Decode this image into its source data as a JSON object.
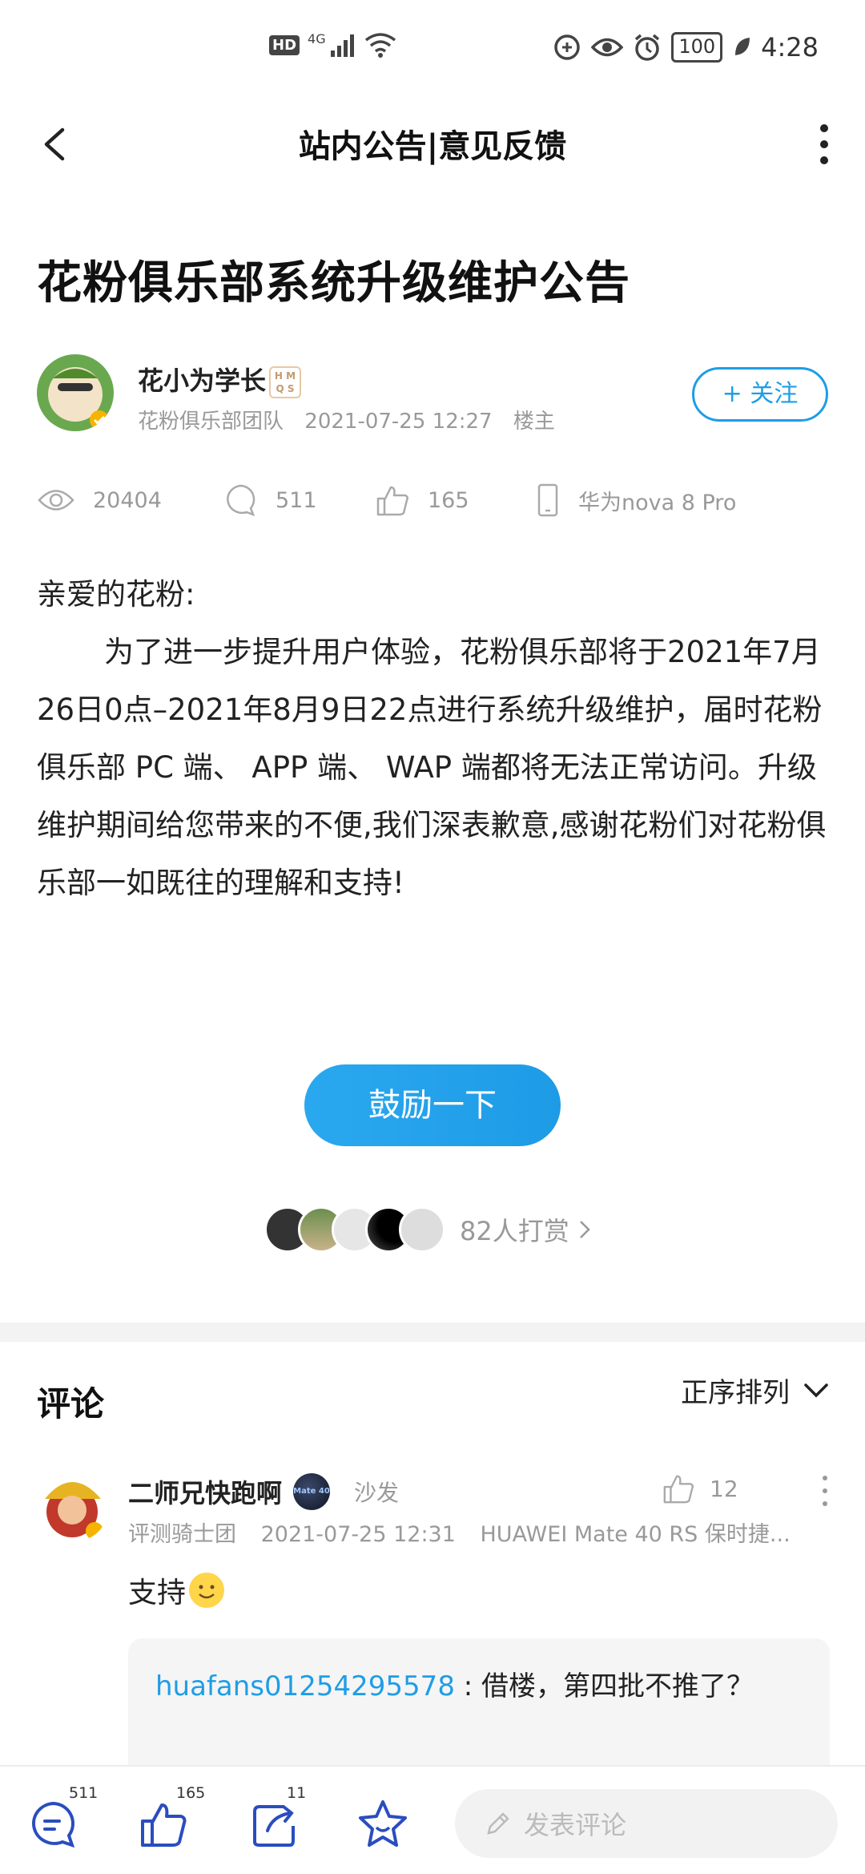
{
  "status_bar": {
    "hd": "HD",
    "network": "4G",
    "battery": "100",
    "time": "4:28"
  },
  "header": {
    "title": "站内公告|意见反馈"
  },
  "post": {
    "title": "花粉俱乐部系统升级维护公告",
    "author": {
      "name": "花小为学长",
      "badge": "H M\nQ S",
      "team": "花粉俱乐部团队",
      "date": "2021-07-25 12:27",
      "role": "楼主"
    },
    "follow_label": "+ 关注",
    "stats": {
      "views": "20404",
      "comments": "511",
      "likes": "165",
      "device": "华为nova 8 Pro"
    },
    "content": {
      "greeting": "亲爱的花粉:",
      "body": "为了进一步提升用户体验，花粉俱乐部将于2021年7月26日0点–2021年8月9日22点进行系统升级维护，届时花粉俱乐部 PC 端、 APP 端、 WAP 端都将无法正常访问。升级维护期间给您带来的不便,我们深表歉意,感谢花粉们对花粉俱乐部一如既往的理解和支持!"
    },
    "cheer_label": "鼓励一下",
    "tips_text": "82人打赏"
  },
  "comments": {
    "title": "评论",
    "sort_label": "正序排列",
    "items": [
      {
        "name": "二师兄快跑啊",
        "level_badge": "Mate 40",
        "floor": "沙发",
        "likes": "12",
        "group": "评测骑士团",
        "date": "2021-07-25 12:31",
        "device": "HUAWEI Mate 40 RS 保时捷...",
        "text": "支持",
        "reply": {
          "user": "huafans01254295578",
          "separator": " : ",
          "text": "借楼，第四批不推了？"
        }
      }
    ]
  },
  "bottom_bar": {
    "comments_count": "511",
    "likes_count": "165",
    "shares_count": "11",
    "input_placeholder": "发表评论"
  },
  "colors": {
    "accent": "#1f9de6",
    "muted": "#999999"
  }
}
